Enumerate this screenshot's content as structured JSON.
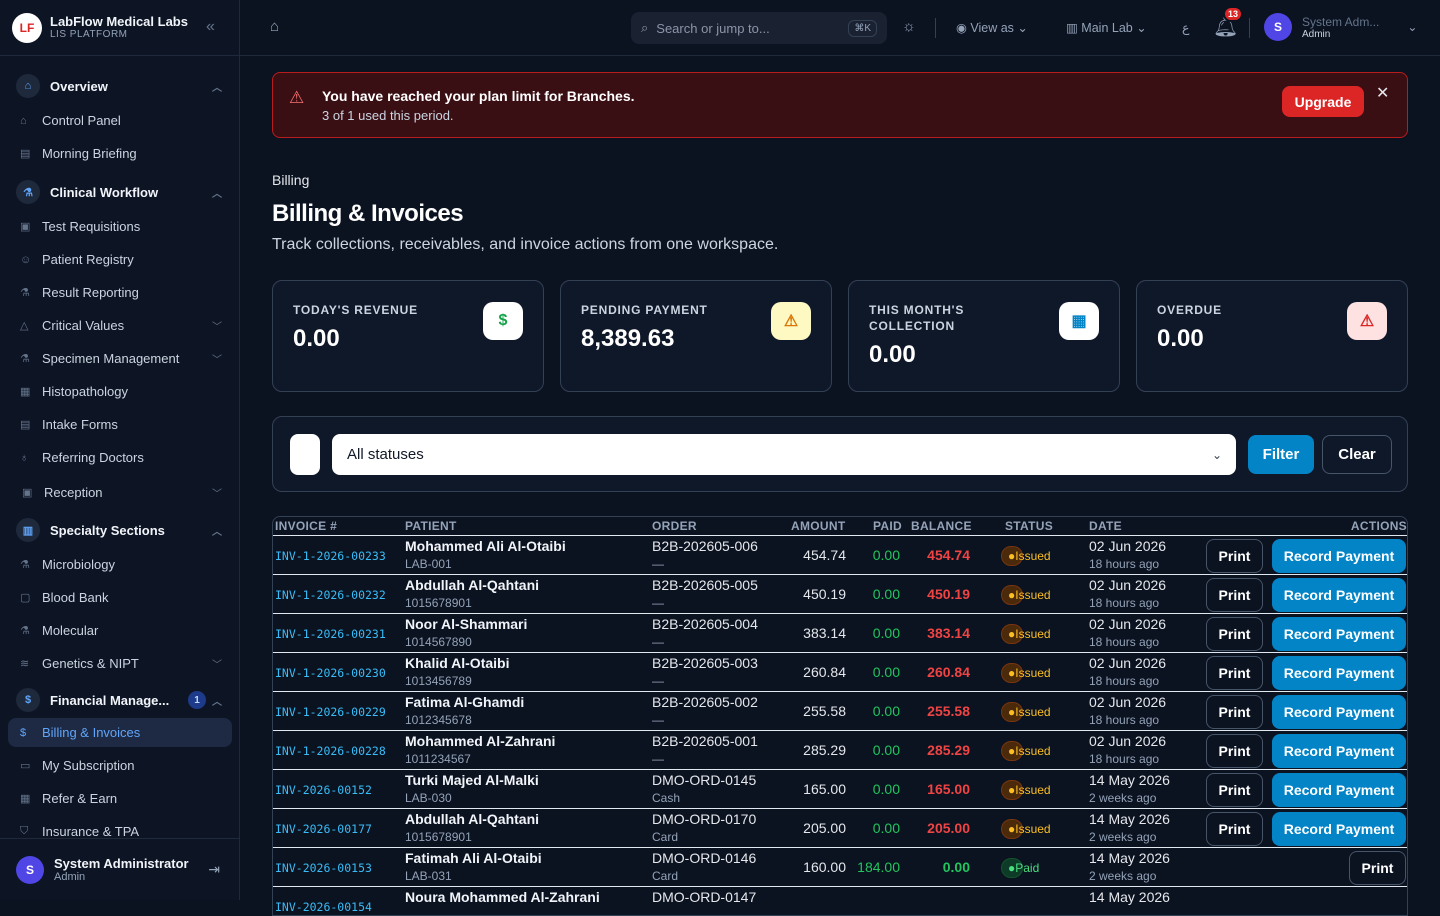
{
  "brand": {
    "name": "LabFlow Medical Labs",
    "sub": "LIS PLATFORM",
    "logo": "LF"
  },
  "sidebar": {
    "overview": "Overview",
    "control_panel": "Control Panel",
    "morning_briefing": "Morning Briefing",
    "clinical": "Clinical Workflow",
    "test_req": "Test Requisitions",
    "patient_reg": "Patient Registry",
    "result_rep": "Result Reporting",
    "critical": "Critical Values",
    "specimen": "Specimen Management",
    "histo": "Histopathology",
    "intake": "Intake Forms",
    "referring": "Referring Doctors",
    "reception": "Reception",
    "specialty": "Specialty Sections",
    "micro": "Microbiology",
    "blood": "Blood Bank",
    "molecular": "Molecular",
    "genetics": "Genetics & NIPT",
    "financial": "Financial Manage...",
    "financial_badge": "1",
    "billing": "Billing & Invoices",
    "subscription": "My Subscription",
    "refer": "Refer & Earn",
    "insurance": "Insurance & TPA"
  },
  "footer_user": {
    "initial": "S",
    "name": "System Administrator",
    "role": "Admin"
  },
  "topbar": {
    "search_placeholder": "Search or jump to...",
    "shortcut": "⌘K",
    "view_as": "View as",
    "branch": "Main Lab",
    "lang": "ع",
    "notif_count": "13",
    "user_name": "System Adm...",
    "user_role": "Admin",
    "user_initial": "S"
  },
  "alert": {
    "title": "You have reached your plan limit for Branches.",
    "subtitle": "3 of 1 used this period.",
    "button": "Upgrade"
  },
  "page": {
    "breadcrumb": "Billing",
    "title": "Billing & Invoices",
    "subtitle": "Track collections, receivables, and invoice actions from one workspace."
  },
  "stats": [
    {
      "label": "TODAY'S REVENUE",
      "value": "0.00",
      "icon": "$",
      "color": "#16a34a"
    },
    {
      "label": "PENDING PAYMENT",
      "value": "8,389.63",
      "icon": "⚠",
      "color": "#d97706"
    },
    {
      "label": "THIS MONTH'S COLLECTION",
      "value": "0.00",
      "icon": "▦",
      "color": "#0284c7"
    },
    {
      "label": "OVERDUE",
      "value": "0.00",
      "icon": "⚠",
      "color": "#dc2626"
    }
  ],
  "filter": {
    "status": "All statuses",
    "filter_btn": "Filter",
    "clear_btn": "Clear"
  },
  "table": {
    "headers": {
      "invoice": "INVOICE #",
      "patient": "PATIENT",
      "order": "ORDER",
      "amount": "AMOUNT",
      "paid": "PAID",
      "balance": "BALANCE",
      "status": "STATUS",
      "date": "DATE",
      "actions": "ACTIONS"
    },
    "print": "Print",
    "record": "Record Payment",
    "rows": [
      {
        "inv": "INV-1-2026-00233",
        "name": "Mohammed Ali Al-Otaibi",
        "pid": "LAB-001",
        "order": "B2B-202605-006",
        "pay": "—",
        "amount": "454.74",
        "paid": "0.00",
        "balance": "454.74",
        "status": "Issued",
        "date": "02 Jun 2026",
        "ago": "18 hours ago"
      },
      {
        "inv": "INV-1-2026-00232",
        "name": "Abdullah Al-Qahtani",
        "pid": "1015678901",
        "order": "B2B-202605-005",
        "pay": "—",
        "amount": "450.19",
        "paid": "0.00",
        "balance": "450.19",
        "status": "Issued",
        "date": "02 Jun 2026",
        "ago": "18 hours ago"
      },
      {
        "inv": "INV-1-2026-00231",
        "name": "Noor Al-Shammari",
        "pid": "1014567890",
        "order": "B2B-202605-004",
        "pay": "—",
        "amount": "383.14",
        "paid": "0.00",
        "balance": "383.14",
        "status": "Issued",
        "date": "02 Jun 2026",
        "ago": "18 hours ago"
      },
      {
        "inv": "INV-1-2026-00230",
        "name": "Khalid Al-Otaibi",
        "pid": "1013456789",
        "order": "B2B-202605-003",
        "pay": "—",
        "amount": "260.84",
        "paid": "0.00",
        "balance": "260.84",
        "status": "Issued",
        "date": "02 Jun 2026",
        "ago": "18 hours ago"
      },
      {
        "inv": "INV-1-2026-00229",
        "name": "Fatima Al-Ghamdi",
        "pid": "1012345678",
        "order": "B2B-202605-002",
        "pay": "—",
        "amount": "255.58",
        "paid": "0.00",
        "balance": "255.58",
        "status": "Issued",
        "date": "02 Jun 2026",
        "ago": "18 hours ago"
      },
      {
        "inv": "INV-1-2026-00228",
        "name": "Mohammed Al-Zahrani",
        "pid": "1011234567",
        "order": "B2B-202605-001",
        "pay": "—",
        "amount": "285.29",
        "paid": "0.00",
        "balance": "285.29",
        "status": "Issued",
        "date": "02 Jun 2026",
        "ago": "18 hours ago"
      },
      {
        "inv": "INV-2026-00152",
        "name": "Turki Majed Al-Malki",
        "pid": "LAB-030",
        "order": "DMO-ORD-0145",
        "pay": "Cash",
        "amount": "165.00",
        "paid": "0.00",
        "balance": "165.00",
        "status": "Issued",
        "date": "14 May 2026",
        "ago": "2 weeks ago"
      },
      {
        "inv": "INV-2026-00177",
        "name": "Abdullah Al-Qahtani",
        "pid": "1015678901",
        "order": "DMO-ORD-0170",
        "pay": "Card",
        "amount": "205.00",
        "paid": "0.00",
        "balance": "205.00",
        "status": "Issued",
        "date": "14 May 2026",
        "ago": "2 weeks ago"
      },
      {
        "inv": "INV-2026-00153",
        "name": "Fatimah Ali Al-Otaibi",
        "pid": "LAB-031",
        "order": "DMO-ORD-0146",
        "pay": "Card",
        "amount": "160.00",
        "paid": "184.00",
        "balance": "0.00",
        "status": "Paid",
        "date": "14 May 2026",
        "ago": "2 weeks ago"
      },
      {
        "inv": "INV-2026-00154",
        "name": "Noura Mohammed Al-Zahrani",
        "pid": "",
        "order": "DMO-ORD-0147",
        "pay": "",
        "amount": "",
        "paid": "",
        "balance": "",
        "status": "",
        "date": "14 May 2026",
        "ago": ""
      }
    ]
  }
}
